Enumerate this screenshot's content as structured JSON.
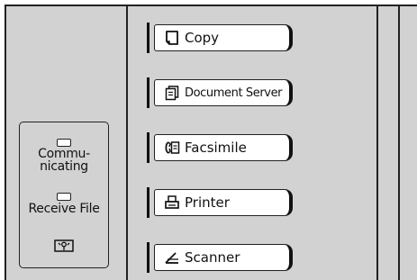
{
  "indicators": {
    "communicating": {
      "label": "Commu-\nnicating",
      "icon": "led-lamp"
    },
    "receive_file": {
      "label": "Receive File",
      "icon": "led-lamp"
    },
    "key_counter": {
      "icon": "key-icon"
    }
  },
  "function_keys": [
    {
      "label": "Copy",
      "icon": "copy-icon"
    },
    {
      "label": "Document Server",
      "icon": "document-server-icon"
    },
    {
      "label": "Facsimile",
      "icon": "facsimile-icon"
    },
    {
      "label": "Printer",
      "icon": "printer-icon"
    },
    {
      "label": "Scanner",
      "icon": "scanner-icon"
    }
  ],
  "colors": {
    "panel": "#d2d2d2",
    "key_face": "#ffffff",
    "outline": "#222222"
  }
}
